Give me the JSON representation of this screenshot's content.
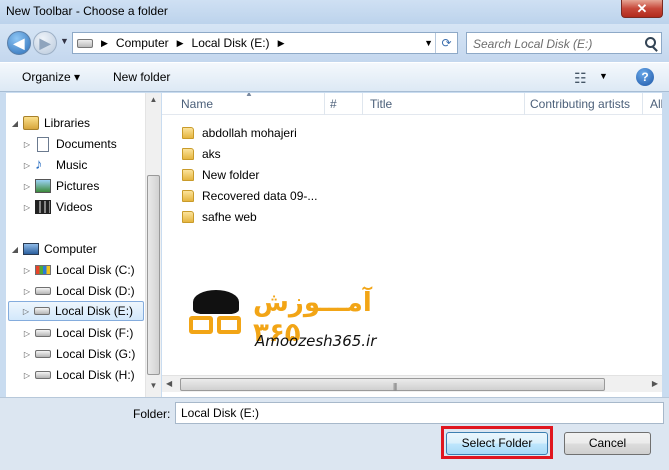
{
  "window": {
    "title": "New Toolbar - Choose a folder",
    "close_label": "✕"
  },
  "nav": {
    "back_label": "◀",
    "forward_label": "▶",
    "recent_label": "▼",
    "breadcrumbs": [
      "Computer",
      "Local Disk (E:)"
    ],
    "separator": "▶",
    "dropdown": "▼",
    "refresh_label": "⟳",
    "search_placeholder": "Search Local Disk (E:)"
  },
  "commands": {
    "organize": "Organize ▾",
    "new_folder": "New folder",
    "view_dd": "▼",
    "help": "?"
  },
  "tree": {
    "libraries": "Libraries",
    "library_items": [
      "Documents",
      "Music",
      "Pictures",
      "Videos"
    ],
    "computer": "Computer",
    "drives": [
      "Local Disk (C:)",
      "Local Disk (D:)",
      "Local Disk (E:)",
      "Local Disk (F:)",
      "Local Disk (G:)",
      "Local Disk (H:)"
    ],
    "selected": "Local Disk (E:)"
  },
  "columns": [
    "Name",
    "#",
    "Title",
    "Contributing artists",
    "Alb"
  ],
  "files": [
    "abdollah mohajeri",
    "aks",
    "New folder",
    "Recovered data 09-...",
    "safhe web"
  ],
  "watermark": {
    "fa_text": "آمـــوزش ۳۶۵",
    "en_text": "Amoozesh365.ir"
  },
  "footer": {
    "folder_label": "Folder:",
    "folder_value": "Local Disk (E:)",
    "select_button": "Select Folder",
    "cancel_button": "Cancel"
  },
  "colors": {
    "highlight": "#e0161f",
    "accent": "#3c7fb1",
    "logo": "#f2a516"
  }
}
